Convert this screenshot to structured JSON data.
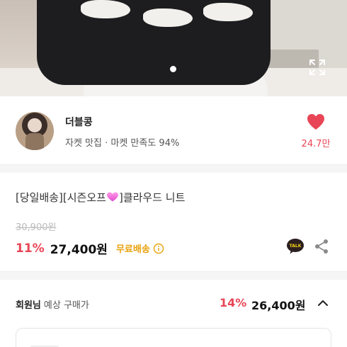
{
  "hero": {
    "image_alt_icon": "expand-icon",
    "carousel_indicator": "dot"
  },
  "seller": {
    "name": "더블콩",
    "subtitle": "자켓 맛집 · 마켓 만족도 94%",
    "like_count": "24.7만",
    "like_icon": "heart-icon",
    "accent_color": "#e84656"
  },
  "product": {
    "title_before": "[당일배송][시즌오프",
    "title_after": "]클라우드 니트",
    "original_price": "30,900원",
    "discount": "11%",
    "price": "27,400원",
    "free_shipping": "무료배송",
    "free_shipping_color": "#e8a20c",
    "icons": [
      "info-icon",
      "kakaotalk-icon",
      "share-icon"
    ]
  },
  "member": {
    "label_bold": "회원님",
    "label_sub": "예상 구매가",
    "discount": "14%",
    "price": "26,400원",
    "toggle_icon": "chevron-up-icon"
  }
}
